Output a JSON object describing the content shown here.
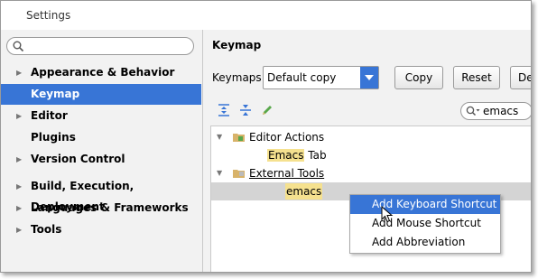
{
  "window": {
    "title": "Settings"
  },
  "sidebar": {
    "search_placeholder": "",
    "items": [
      {
        "label": "Appearance & Behavior",
        "expandable": true,
        "selected": false
      },
      {
        "label": "Keymap",
        "expandable": false,
        "selected": true
      },
      {
        "label": "Editor",
        "expandable": true,
        "selected": false
      },
      {
        "label": "Plugins",
        "expandable": false,
        "selected": false
      },
      {
        "label": "Version Control",
        "expandable": true,
        "selected": false
      },
      {
        "label": "Build, Execution, Deployment",
        "expandable": true,
        "selected": false
      },
      {
        "label": "Languages & Frameworks",
        "expandable": true,
        "selected": false
      },
      {
        "label": "Tools",
        "expandable": true,
        "selected": false
      }
    ]
  },
  "main": {
    "heading": "Keymap",
    "keymaps_label": "Keymaps:",
    "keymap_value": "Default copy",
    "buttons": {
      "copy": "Copy",
      "reset": "Reset",
      "delete": "De"
    },
    "filter_value": "emacs",
    "tree": {
      "editor_actions": "Editor Actions",
      "emacs_tab_highlight": "Emacs",
      "emacs_tab_rest": " Tab",
      "external_tools": "External Tools",
      "emacs_item": "emacs"
    }
  },
  "context_menu": {
    "items": [
      "Add Keyboard Shortcut",
      "Add Mouse Shortcut",
      "Add Abbreviation"
    ]
  },
  "colors": {
    "accent": "#3875d6",
    "highlight": "#f5e18f"
  }
}
